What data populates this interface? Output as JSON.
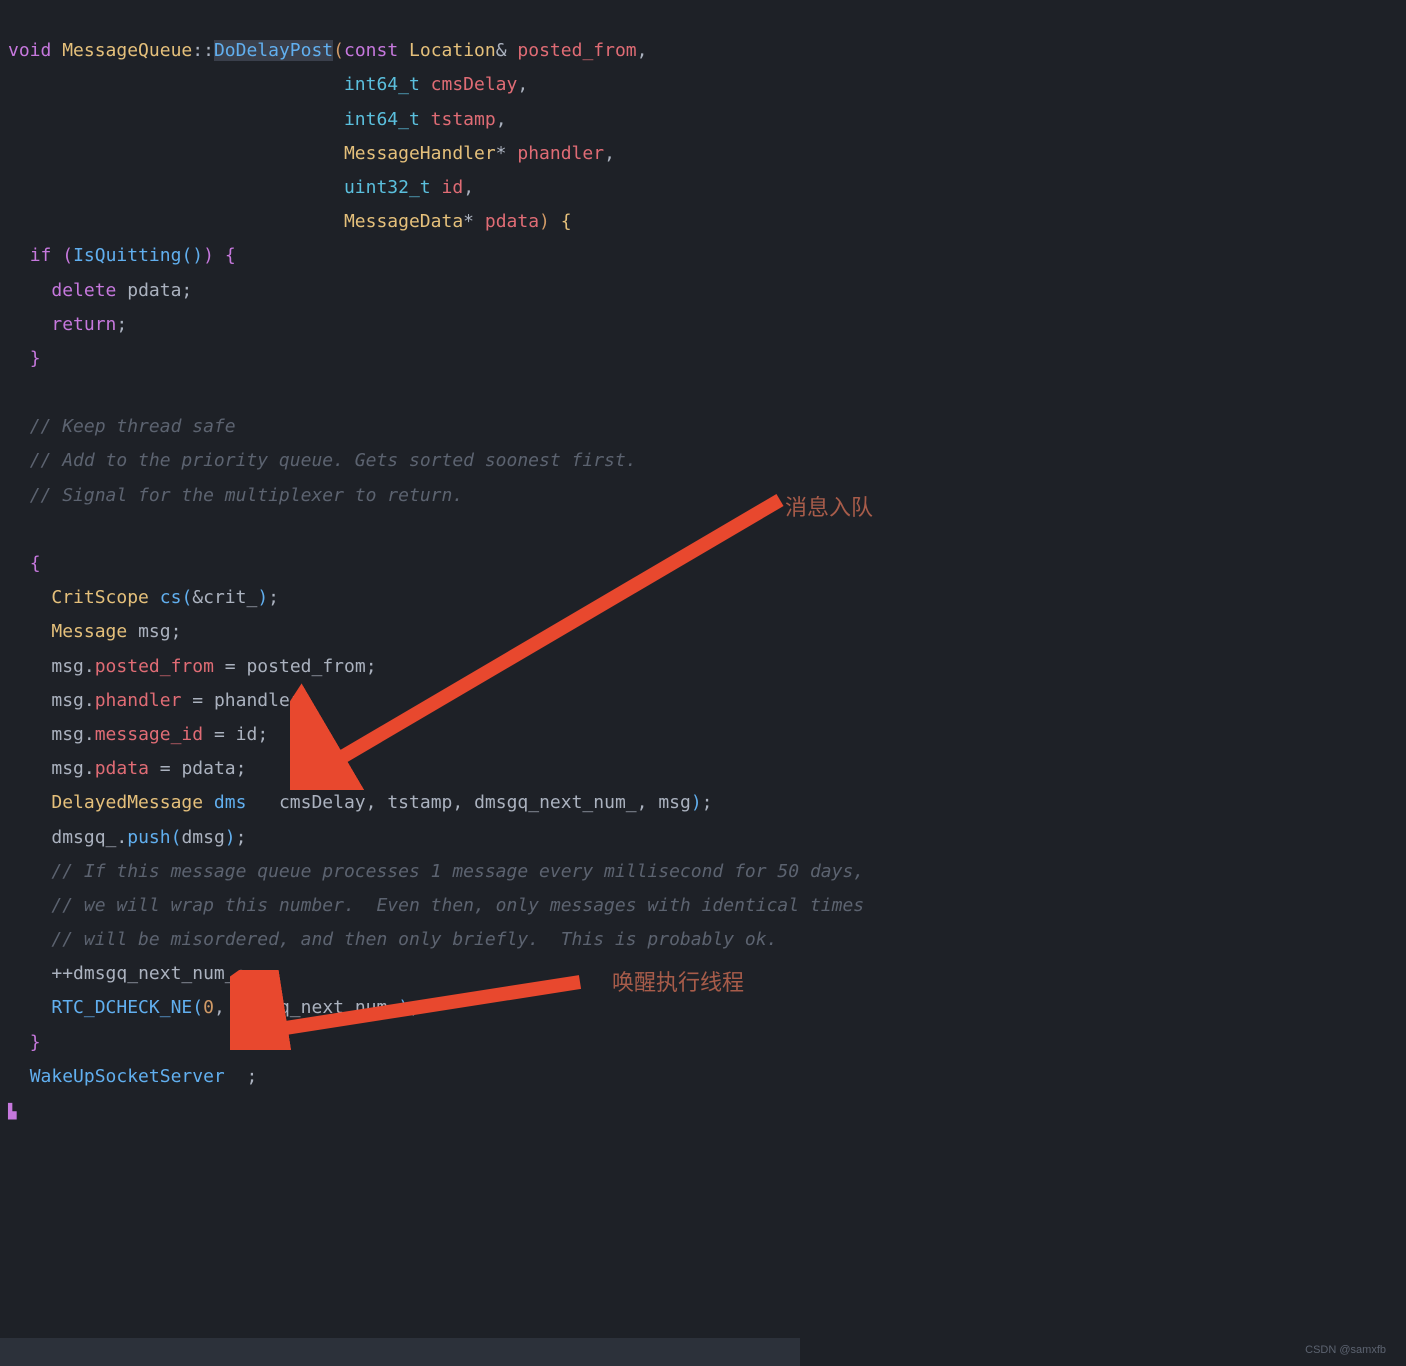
{
  "code": {
    "l1_void": "void",
    "l1_class": "MessageQueue",
    "l1_scope": "::",
    "l1_fn": "DoDelayPost",
    "l1_const": "const",
    "l1_type1": "Location",
    "l1_amp": "&",
    "l1_param1": "posted_from",
    "l2_type": "int64_t",
    "l2_param": "cmsDelay",
    "l3_type": "int64_t",
    "l3_param": "tstamp",
    "l4_type": "MessageHandler",
    "l4_star": "*",
    "l4_param": "phandler",
    "l5_type": "uint32_t",
    "l5_param": "id",
    "l6_type": "MessageData",
    "l6_star": "*",
    "l6_param": "pdata",
    "l7_if": "if",
    "l7_fn": "IsQuitting",
    "l8_delete": "delete",
    "l8_var": "pdata",
    "l9_return": "return",
    "c1": "// Keep thread safe",
    "c2": "// Add to the priority queue. Gets sorted soonest first.",
    "c3": "// Signal for the multiplexer to return.",
    "l15_type": "CritScope",
    "l15_var": "cs",
    "l15_arg": "crit_",
    "l16_type": "Message",
    "l16_var": "msg",
    "l17_obj": "msg",
    "l17_mem": "posted_from",
    "l17_val": "posted_from",
    "l18_obj": "msg",
    "l18_mem": "phandler",
    "l18_val": "phandler",
    "l19_obj": "msg",
    "l19_mem": "message_id",
    "l19_val": "id",
    "l20_obj": "msg",
    "l20_mem": "pdata",
    "l20_val": "pdata",
    "l21_type": "DelayedMessage",
    "l21_var": "dmsg",
    "l21_a1a": "",
    "l21_a1b": "cmsDelay",
    "l21_a2": "tstamp",
    "l21_a3": "dmsgq_next_num_",
    "l21_a4": "msg",
    "l22_obj": "dmsgq_",
    "l22_fn": "push",
    "l22_arg": "dmsg",
    "c4": "// If this message queue processes 1 message every millisecond for 50 days,",
    "c5": "// we will wrap this number.  Even then, only messages with identical times",
    "c6": "// will be misordered, and then only briefly.  This is probably ok.",
    "l26_var": "dmsgq_next_num_",
    "l27_fn": "RTC_DCHECK_NE",
    "l27_a1": "0",
    "l27_a2": "dmsgq_next_num_",
    "l29_fn": "WakeUpSocketServer"
  },
  "annotations": {
    "a1": "消息入队",
    "a2": "唤醒执行线程"
  },
  "watermark": "CSDN @samxfb"
}
